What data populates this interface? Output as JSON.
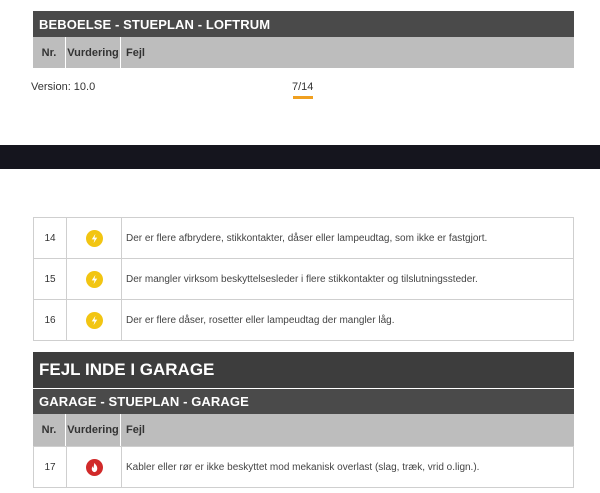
{
  "top_section": {
    "header": "BEBOELSE - STUEPLAN - LOFTRUM",
    "columns": [
      "Nr.",
      "Vurdering",
      "Fejl"
    ]
  },
  "footer": {
    "version": "Version: 10.0",
    "page": "7/14"
  },
  "rows": [
    {
      "nr": "14",
      "icon": "lightning-icon",
      "text": "Der er flere afbrydere, stikkontakter, dåser eller lampeudtag, som ikke er fastgjort."
    },
    {
      "nr": "15",
      "icon": "lightning-icon",
      "text": "Der mangler virksom beskyttelsesleder i flere stikkontakter og tilslutningssteder."
    },
    {
      "nr": "16",
      "icon": "lightning-icon",
      "text": "Der er flere dåser, rosetter eller lampeudtag der mangler låg."
    }
  ],
  "garage": {
    "title": "FEJL INDE I GARAGE",
    "header": "GARAGE - STUEPLAN - GARAGE",
    "columns": [
      "Nr.",
      "Vurdering",
      "Fejl"
    ],
    "rows": [
      {
        "nr": "17",
        "icon": "fire-icon",
        "text": "Kabler eller rør er ikke beskyttet mod mekanisk overlast (slag, træk, vrid o.lign.)."
      }
    ]
  },
  "colors": {
    "section_header": "#4a4a4a",
    "column_header": "#bdbdbd",
    "dark_band": "#15151e",
    "page_accent": "#f0a020",
    "lightning": "#f2c512",
    "fire": "#d12a2a"
  }
}
